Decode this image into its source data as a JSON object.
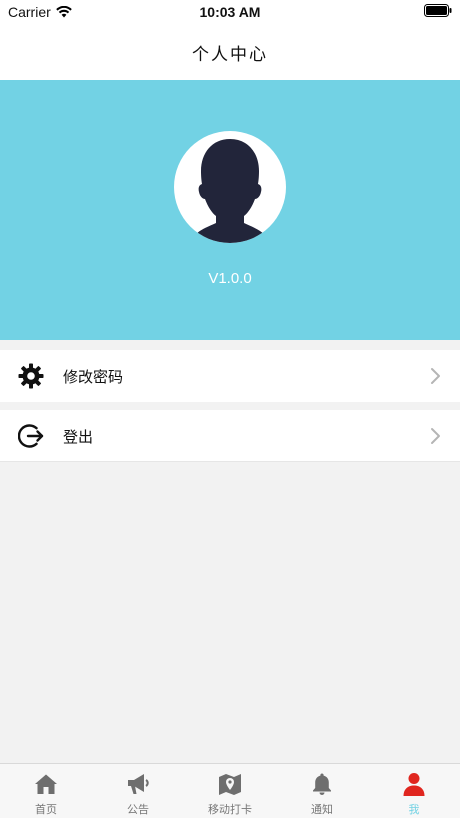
{
  "status_bar": {
    "carrier": "Carrier",
    "time": "10:03 AM"
  },
  "nav": {
    "title": "个人中心"
  },
  "profile": {
    "version": "V1.0.0",
    "header_color": "#72d2e4"
  },
  "menu": {
    "items": [
      {
        "label": "修改密码",
        "icon": "gear-icon"
      },
      {
        "label": "登出",
        "icon": "logout-icon"
      }
    ]
  },
  "tab_bar": {
    "tabs": [
      {
        "label": "首页",
        "icon": "home-icon"
      },
      {
        "label": "公告",
        "icon": "megaphone-icon"
      },
      {
        "label": "移动打卡",
        "icon": "map-pin-icon"
      },
      {
        "label": "通知",
        "icon": "bell-icon"
      },
      {
        "label": "我",
        "icon": "person-icon"
      }
    ],
    "active_index": 4,
    "active_color": "#72d2e4",
    "active_icon_color": "#e0261f",
    "inactive_color": "#777777"
  }
}
